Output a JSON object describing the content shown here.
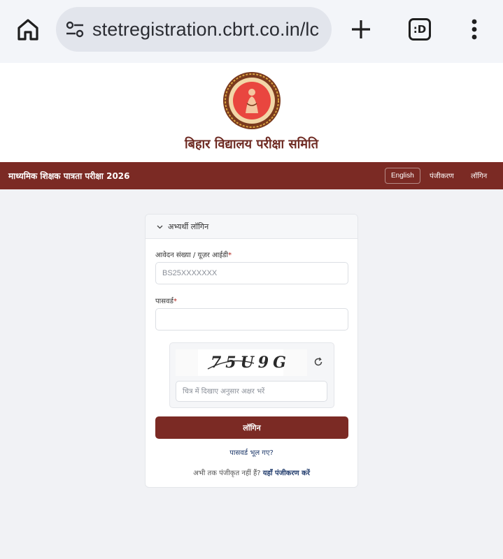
{
  "browser": {
    "url": "stetregistration.cbrt.co.in/lc",
    "icons": {
      "home": "home-icon",
      "site_info": "tune-icon",
      "new_tab": "plus-icon",
      "tabs": "tab-switcher-icon",
      "menu": "more-vert-icon"
    },
    "tab_switcher_label": ":D"
  },
  "site": {
    "org_name": "बिहार विद्यालय परीक्षा समिति",
    "logo_icon": "bseb-emblem-icon"
  },
  "navbar": {
    "title": "माध्यमिक शिक्षक पात्रता परीक्षा 2026",
    "language_button": "English",
    "registration_link": "पंजीकरण",
    "login_link": "लॉगिन",
    "color": "#7b2a24"
  },
  "login_card": {
    "header_title": "अभ्यर्थी लॉगिन",
    "user_id": {
      "label": "आवेदन संख्या / यूज़र आईडी",
      "required_mark": "*",
      "placeholder": "BS25XXXXXXX",
      "value": ""
    },
    "password": {
      "label": "पासवर्ड",
      "required_mark": "*",
      "placeholder": "",
      "value": ""
    },
    "captcha": {
      "image_text": "75U9G",
      "placeholder": "चित्र में दिखाए अनुसार अक्षर भरें",
      "refresh_icon": "refresh-icon"
    },
    "login_button": "लॉगिन",
    "forgot_password": "पासवर्ड भूल गए?",
    "not_registered_text": "अभी तक पंजीकृत नहीं हैं?",
    "register_link": "यहाँ पंजीकरण करें"
  }
}
